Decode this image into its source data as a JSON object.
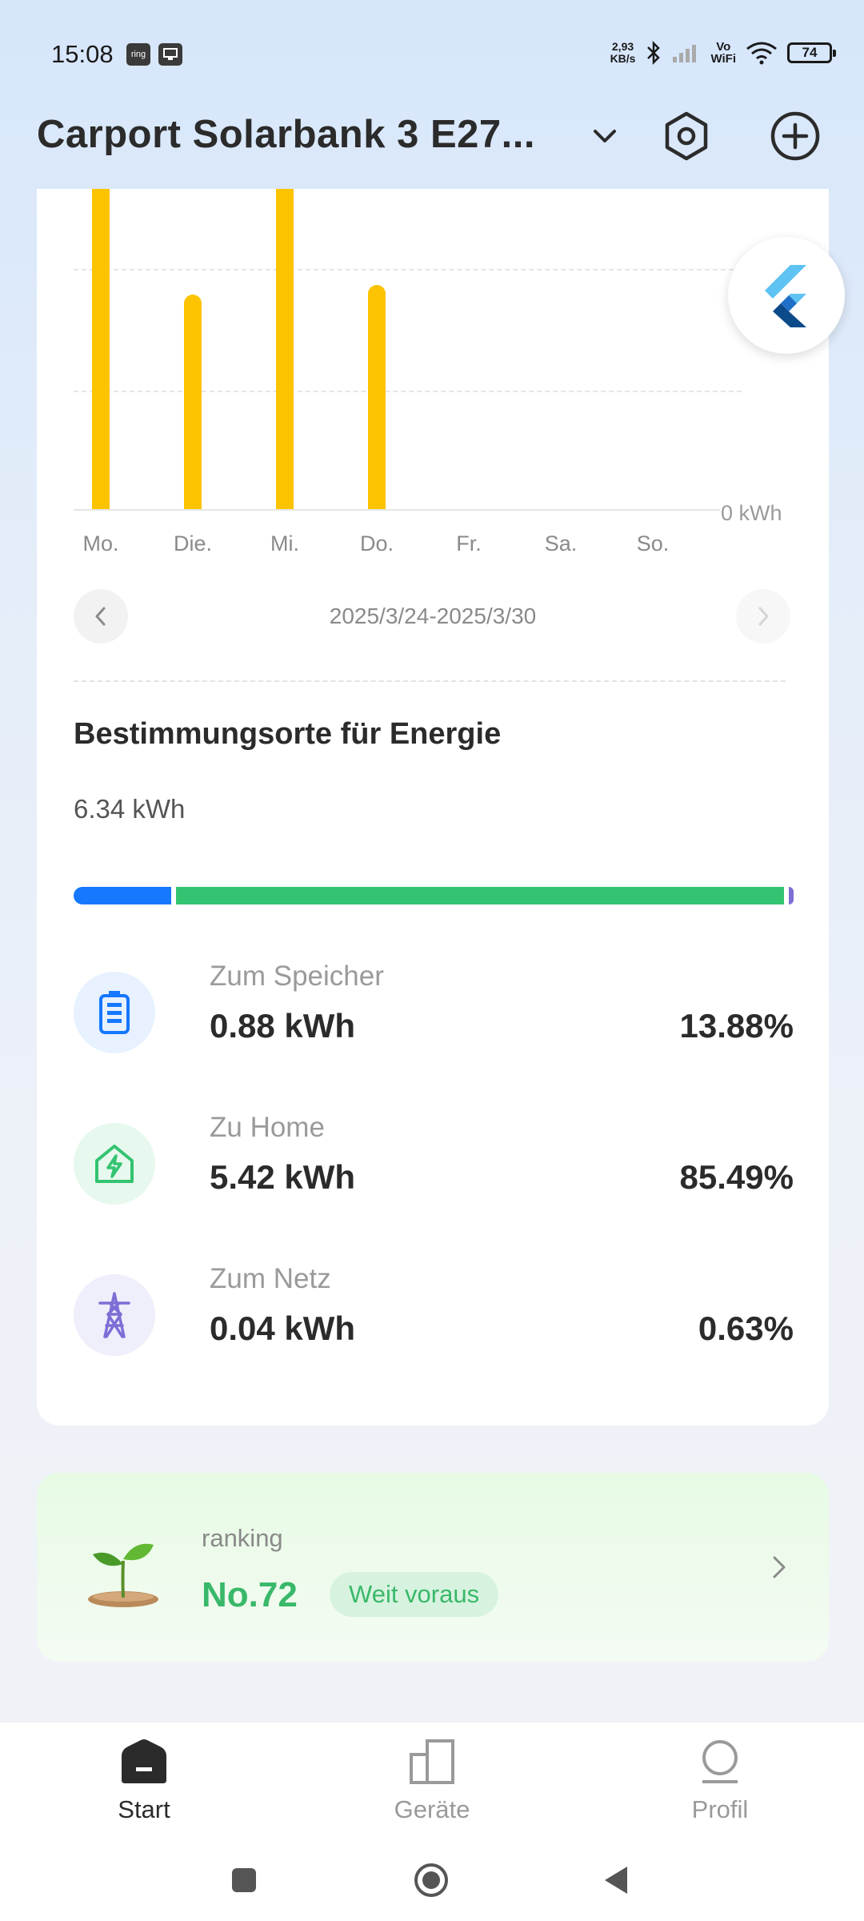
{
  "status_bar": {
    "time": "15:08",
    "net_speed": "2,93",
    "net_unit": "KB/s",
    "wifi_label_top": "Vo",
    "wifi_label_bottom": "WiFi",
    "battery": "74",
    "app_icon_1": "ring"
  },
  "header": {
    "title": "Carport Solarbank 3 E27...",
    "icons": [
      "chevron-down-icon",
      "settings-hex-icon",
      "add-circle-icon"
    ]
  },
  "chart_data": {
    "type": "bar",
    "categories": [
      "Mo.",
      "Die.",
      "Mi.",
      "Do.",
      "Fr.",
      "Sa.",
      "So."
    ],
    "values": [
      1.0,
      0.67,
      1.0,
      0.7,
      0,
      0,
      0
    ],
    "ylabel": "",
    "y_tick_label": "0 kWh",
    "color": "#fcc300",
    "note_scale": "bars clipped at top; relative heights only"
  },
  "date_nav": {
    "range": "2025/3/24-2025/3/30"
  },
  "destinations": {
    "title": "Bestimmungsorte für Energie",
    "total": "6.34 kWh",
    "bar_colors": {
      "storage": "#1677ff",
      "home": "#34c471",
      "grid": "#7b6fd6"
    },
    "items": [
      {
        "label": "Zum Speicher",
        "value": "0.88 kWh",
        "percent": "13.88%",
        "icon": "battery-icon",
        "color": "#1677ff",
        "bg": "#e7f1ff"
      },
      {
        "label": "Zu Home",
        "value": "5.42 kWh",
        "percent": "85.49%",
        "icon": "home-lightning-icon",
        "color": "#34c471",
        "bg": "#e7f8ee"
      },
      {
        "label": "Zum Netz",
        "value": "0.04 kWh",
        "percent": "0.63%",
        "icon": "power-tower-icon",
        "color": "#7b6fd6",
        "bg": "#efeefb"
      }
    ]
  },
  "ranking": {
    "label": "ranking",
    "value": "No.72",
    "badge": "Weit voraus"
  },
  "bottom_nav": {
    "items": [
      {
        "label": "Start",
        "active": true
      },
      {
        "label": "Geräte",
        "active": false
      },
      {
        "label": "Profil",
        "active": false
      }
    ]
  }
}
